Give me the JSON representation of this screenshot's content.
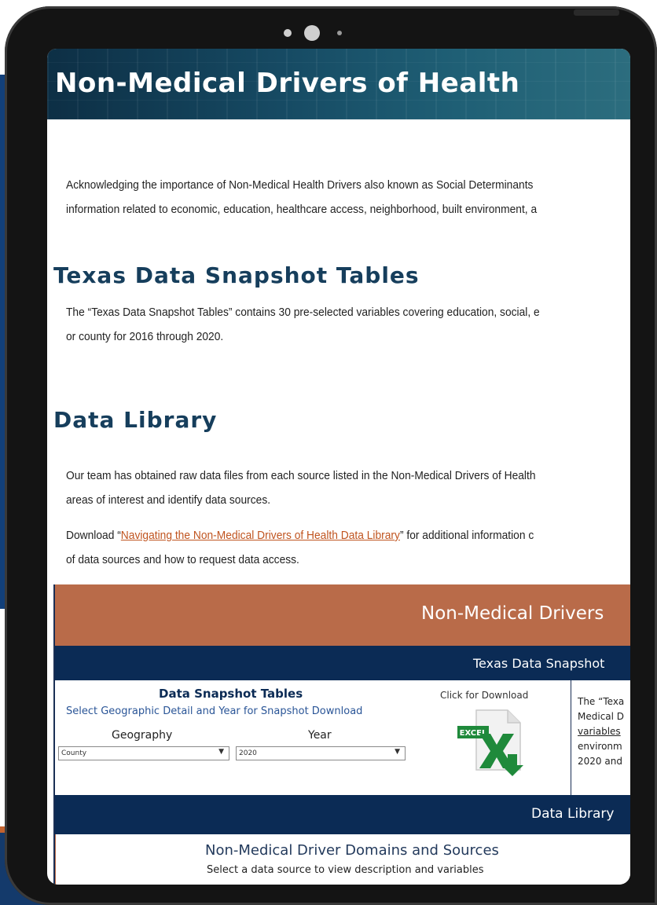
{
  "page": {
    "title": "Non-Medical Drivers of Health",
    "intro_lines": [
      "Acknowledging the importance of Non-Medical Health Drivers also known as Social Determinants",
      "information related to economic, education, healthcare access, neighborhood, built environment, a"
    ],
    "snapshot_heading": "Texas Data Snapshot Tables",
    "snapshot_lines": [
      "The “Texas Data Snapshot Tables” contains 30 pre-selected variables covering education, social, e",
      "or county for 2016 through 2020."
    ],
    "library_heading": "Data Library",
    "library_lines": [
      "Our team has obtained raw data files from each source listed in the Non-Medical Drivers of Health",
      "areas of interest and identify data sources."
    ],
    "download_prefix": "Download “",
    "download_link": "Navigating the Non-Medical Drivers of Health Data Library",
    "download_suffix": "” for additional information c",
    "download_line2": "of data sources and how to request data access."
  },
  "dashboard": {
    "title": "Non-Medical Drivers",
    "snapshot_bar": "Texas Data Snapshot",
    "snapshot_title": "Data Snapshot Tables",
    "snapshot_subtitle": "Select Geographic Detail and Year for Snapshot Download",
    "geography_label": "Geography",
    "geography_value": "County",
    "year_label": "Year",
    "year_value": "2020",
    "click_download": "Click for Download",
    "excel_icon_label": "EXCEL",
    "side_text_lines": [
      "The “Texa",
      "Medical D",
      "variables",
      "environm",
      "2020 and"
    ],
    "library_bar": "Data Library",
    "domains_title": "Non-Medical Driver Domains and Sources",
    "domains_subtitle": "Select a data source to view description and variables"
  },
  "colors": {
    "header_teal": "#164a63",
    "heading_navy": "#163e5c",
    "dashboard_rust": "#b96b49",
    "dashboard_navy": "#0b2b55",
    "link_orange": "#c0541f",
    "excel_green": "#1f8a3b"
  }
}
